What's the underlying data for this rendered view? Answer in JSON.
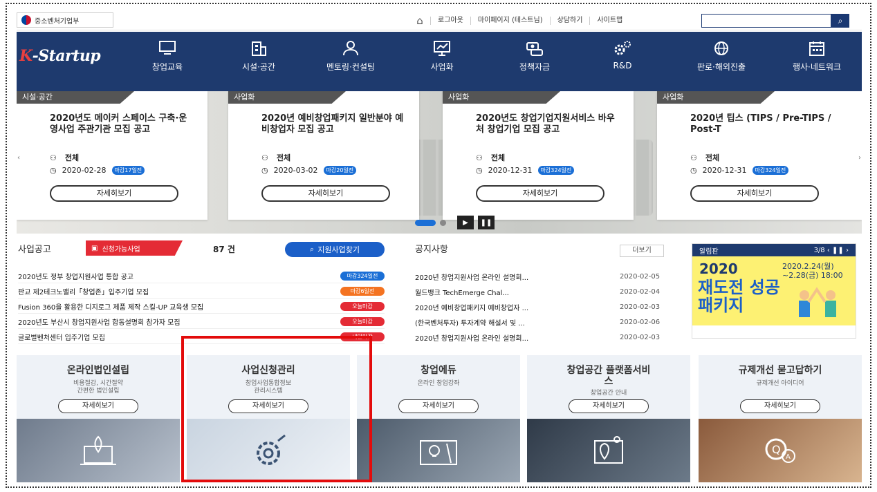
{
  "topbar": {
    "gov_label": "중소벤처기업부",
    "links": [
      "로그아웃",
      "마이페이지 (테스트님)",
      "상담하기",
      "사이트맵"
    ],
    "search_placeholder": ""
  },
  "nav": {
    "logo": "K-Startup",
    "items": [
      {
        "label": "창업교육",
        "icon": "monitor-icon"
      },
      {
        "label": "시설·공간",
        "icon": "building-icon"
      },
      {
        "label": "멘토링·컨설팅",
        "icon": "mentor-icon"
      },
      {
        "label": "사업화",
        "icon": "chart-board-icon"
      },
      {
        "label": "정책자금",
        "icon": "money-icon"
      },
      {
        "label": "R&D",
        "icon": "gears-icon"
      },
      {
        "label": "판로·해외진출",
        "icon": "globe-icon"
      },
      {
        "label": "행사·네트워크",
        "icon": "calendar-icon"
      }
    ]
  },
  "slider": {
    "cards": [
      {
        "tag": "시설·공간",
        "title": "2020년도 메이커 스페이스 구축·운영사업 주관기관 모집 공고",
        "target": "전체",
        "date": "2020-02-28",
        "deadline": "마감17일전",
        "more": "자세히보기"
      },
      {
        "tag": "사업화",
        "title": "2020년 예비창업패키지 일반분야 예비창업자 모집 공고",
        "target": "전체",
        "date": "2020-03-02",
        "deadline": "마감20일전",
        "more": "자세히보기"
      },
      {
        "tag": "사업화",
        "title": "2020년도 창업기업지원서비스 바우처 창업기업 모집 공고",
        "target": "전체",
        "date": "2020-12-31",
        "deadline": "마감324일전",
        "more": "자세히보기"
      },
      {
        "tag": "사업화",
        "title": "2020년 팁스 (TIPS / Pre-TIPS / Post-T",
        "target": "전체",
        "date": "2020-12-31",
        "deadline": "마감324일전",
        "more": "자세히보기"
      }
    ]
  },
  "business": {
    "heading": "사업공고",
    "tag": "신청가능사업",
    "count": "87 건",
    "find_button": "지원사업찾기",
    "rows": [
      {
        "title": "2020년도 정부 창업지원사업 통합 공고",
        "badge": "마감324일전",
        "color": "blue"
      },
      {
        "title": "판교 제2테크노밸리「창업존」입주기업 모집",
        "badge": "마감6일전",
        "color": "orange"
      },
      {
        "title": "Fusion 360을 활용한 디지로그 제품 제작 스킬-UP 교육생 모집",
        "badge": "오늘마감",
        "color": "red"
      },
      {
        "title": "2020년도 부산시 창업지원사업 합동설명회 참가자 모집",
        "badge": "오늘마감",
        "color": "red"
      },
      {
        "title": "글로벌벤처센터 입주기업 모집",
        "badge": "내일마감",
        "color": "red"
      }
    ]
  },
  "notices": {
    "heading": "공지사항",
    "more": "더보기",
    "rows": [
      {
        "title": "2020년 창업지원사업 온라인 설명회...",
        "date": "2020-02-05"
      },
      {
        "title": "월드뱅크 TechEmerge Chal...",
        "date": "2020-02-04"
      },
      {
        "title": "2020년 예비창업패키지 예비창업자 ...",
        "date": "2020-02-03"
      },
      {
        "title": "(한국벤처투자) 투자계약 해설서 및 ...",
        "date": "2020-02-06"
      },
      {
        "title": "2020년 창업지원사업 온라인 설명회...",
        "date": "2020-02-03"
      }
    ]
  },
  "alarm": {
    "heading": "알림판",
    "paging": "3/8",
    "year": "2020",
    "date_line1": "2020.2.24(월)",
    "date_line2": "~2.28(금) 18:00",
    "headline": "재도전 성공 패키지"
  },
  "services": [
    {
      "title": "온라인법인설립",
      "sub": [
        "비용절감, 시간절약",
        "간편한 법인설립"
      ],
      "button": "자세히보기",
      "icon": "laptop-rocket-icon"
    },
    {
      "title": "사업신청관리",
      "sub": [
        "창업사업통합정보",
        "관리시스템"
      ],
      "button": "자세히보기",
      "icon": "gear-icon"
    },
    {
      "title": "창업에듀",
      "sub": [
        "온라인 창업강좌"
      ],
      "button": "자세히보기",
      "icon": "bulb-pencil-icon"
    },
    {
      "title": "창업공간 플랫폼서비스",
      "sub": [
        "창업공간 안내"
      ],
      "button": "자세히보기",
      "icon": "map-pin-icon"
    },
    {
      "title": "규제개선 묻고답하기",
      "sub": [
        "규제개선 아이디어"
      ],
      "button": "자세히보기",
      "icon": "qa-bubble-icon"
    }
  ],
  "colors": {
    "nav": "#1e3a6e",
    "accent": "#1b6fd6",
    "red": "#e42b35",
    "highlight": "#e30b0b"
  }
}
